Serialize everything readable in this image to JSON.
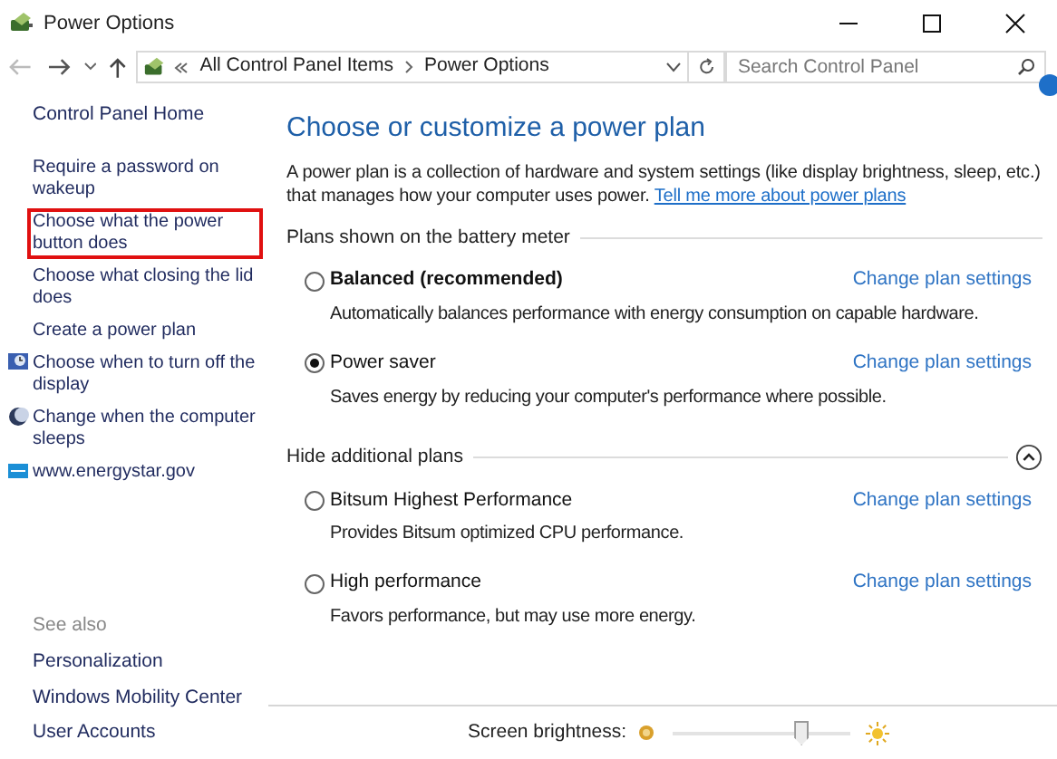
{
  "window": {
    "title": "Power Options"
  },
  "address_bar": {
    "crumbs": [
      "All Control Panel Items",
      "Power Options"
    ]
  },
  "search": {
    "placeholder": "Search Control Panel"
  },
  "sidebar": {
    "home": "Control Panel Home",
    "tasks": [
      {
        "label": "Require a password on wakeup",
        "kind": "plain",
        "highlighted": false
      },
      {
        "label": "Choose what the power button does",
        "kind": "plain",
        "highlighted": true
      },
      {
        "label": "Choose what closing the lid does",
        "kind": "plain",
        "highlighted": false
      },
      {
        "label": "Create a power plan",
        "kind": "plain",
        "highlighted": false
      },
      {
        "label": "Choose when to turn off the display",
        "kind": "display",
        "highlighted": false
      },
      {
        "label": "Change when the computer sleeps",
        "kind": "sleep",
        "highlighted": false
      },
      {
        "label": "www.energystar.gov",
        "kind": "web",
        "highlighted": false
      }
    ],
    "see_also": {
      "heading": "See also",
      "links": [
        "Personalization",
        "Windows Mobility Center",
        "User Accounts"
      ]
    }
  },
  "main": {
    "title": "Choose or customize a power plan",
    "intro": "A power plan is a collection of hardware and system settings (like display brightness, sleep, etc.) that manages how your computer uses power.",
    "intro_link": "Tell me more about power plans",
    "groups": [
      {
        "heading": "Plans shown on the battery meter",
        "plans": [
          {
            "name": "Balanced (recommended)",
            "emphasized": true,
            "selected": false,
            "description": "Automatically balances performance with energy consumption on capable hardware.",
            "link": "Change plan settings"
          },
          {
            "name": "Power saver",
            "emphasized": false,
            "selected": true,
            "description": "Saves energy by reducing your computer's performance where possible.",
            "link": "Change plan settings"
          }
        ]
      },
      {
        "heading": "Hide additional plans",
        "expanded": true,
        "plans": [
          {
            "name": "Bitsum Highest Performance",
            "emphasized": false,
            "selected": false,
            "description": "Provides Bitsum optimized CPU performance.",
            "link": "Change plan settings"
          },
          {
            "name": "High performance",
            "emphasized": false,
            "selected": false,
            "description": "Favors performance, but may use more energy.",
            "link": "Change plan settings"
          }
        ]
      }
    ]
  },
  "brightness": {
    "label": "Screen brightness:",
    "level": 0.73
  }
}
